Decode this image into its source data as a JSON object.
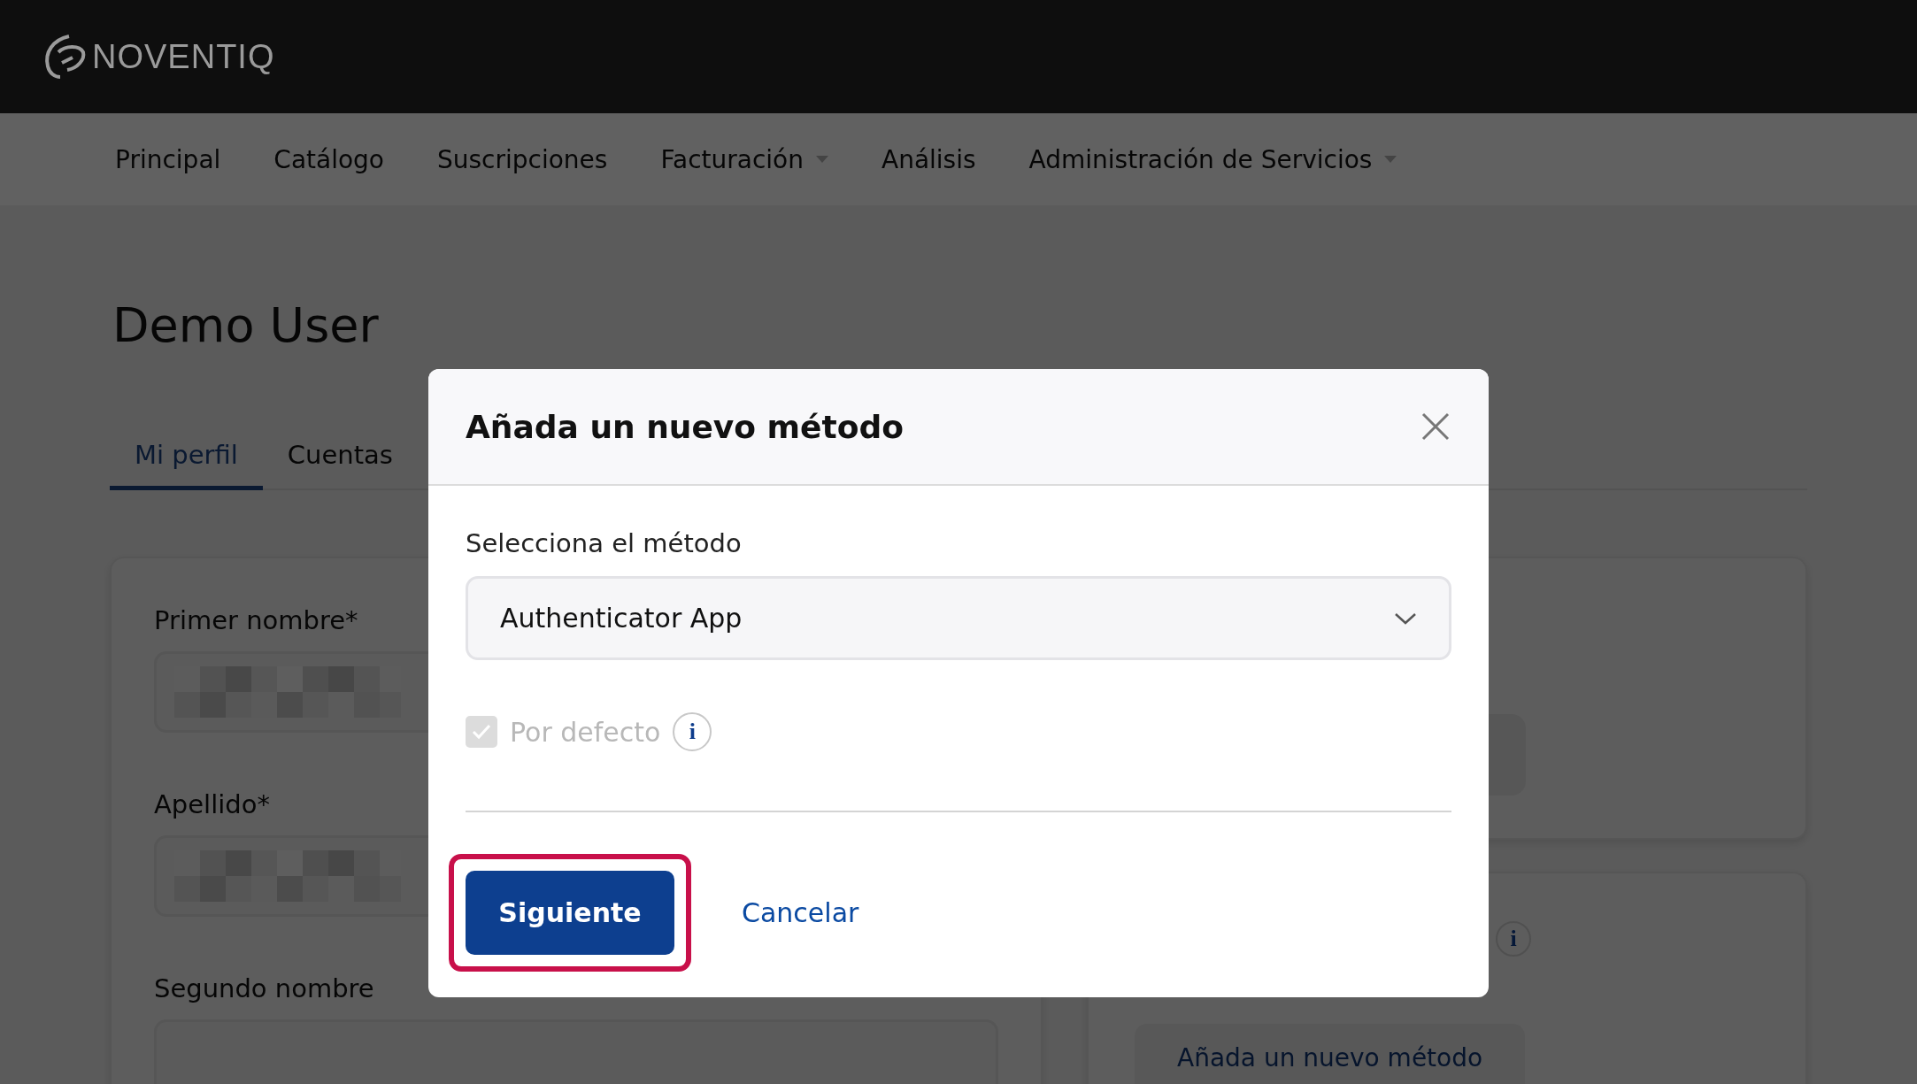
{
  "header": {
    "logo": "NOVENTIQ"
  },
  "nav": [
    {
      "label": "Principal",
      "has_menu": false
    },
    {
      "label": "Catálogo",
      "has_menu": false
    },
    {
      "label": "Suscripciones",
      "has_menu": false
    },
    {
      "label": "Facturación",
      "has_menu": true
    },
    {
      "label": "Análisis",
      "has_menu": false
    },
    {
      "label": "Administración de Servicios",
      "has_menu": true
    }
  ],
  "page": {
    "title": "Demo User",
    "tabs": [
      {
        "label": "Mi perfil",
        "selected": true
      },
      {
        "label": "Cuentas",
        "selected": false
      }
    ],
    "profile_fields": [
      {
        "label": "Primer nombre*",
        "redacted": true
      },
      {
        "label": "Apellido*",
        "redacted": true
      },
      {
        "label": "Segundo nombre",
        "redacted": false
      }
    ],
    "security_card": {
      "info_icon": "i",
      "add_method_button": "Añada un nuevo método"
    }
  },
  "dialog": {
    "title": "Añada un nuevo método",
    "method_label": "Selecciona el método",
    "method_value": "Authenticator App",
    "default_option": {
      "label": "Por defecto",
      "checked": true,
      "disabled": true,
      "info_icon": "i"
    },
    "buttons": [
      {
        "label": "Siguiente",
        "kind": "primary",
        "highlighted": true
      },
      {
        "label": "Cancelar",
        "kind": "link",
        "highlighted": false
      }
    ]
  }
}
